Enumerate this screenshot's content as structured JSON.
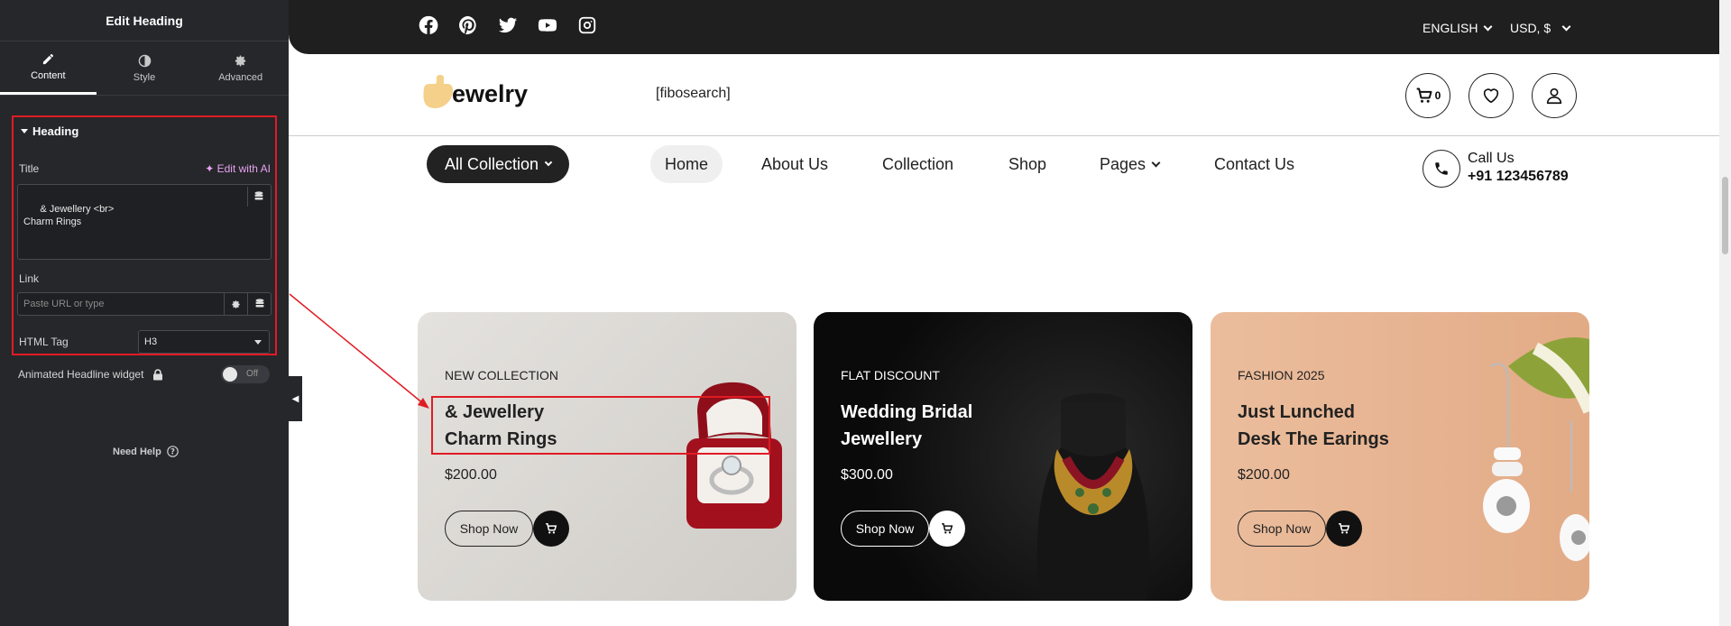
{
  "panel": {
    "title": "Edit Heading",
    "tabs": [
      {
        "label": "Content",
        "icon": "pencil-icon",
        "active": true
      },
      {
        "label": "Style",
        "icon": "half-circle-icon",
        "active": false
      },
      {
        "label": "Advanced",
        "icon": "gear-icon",
        "active": false
      }
    ],
    "section_title": "Heading",
    "title_label": "Title",
    "edit_ai": "Edit with AI",
    "title_value": "& Jewellery <br>\nCharm Rings",
    "link_label": "Link",
    "link_placeholder": "Paste URL or type",
    "html_tag_label": "HTML Tag",
    "html_tag_value": "H3",
    "animated_label": "Animated Headline widget",
    "toggle_label": "Off",
    "need_help": "Need Help"
  },
  "site": {
    "languages": "ENGLISH",
    "currency": "USD, $",
    "logo_text": "Jewelry",
    "search_shortcode": "[fibosearch]",
    "cart_count": "0",
    "all_collection": "All Collection",
    "nav": [
      "Home",
      "About Us",
      "Collection",
      "Shop",
      "Pages",
      "Contact Us"
    ],
    "call_label": "Call Us",
    "call_number": "+91 123456789",
    "social_icons": [
      "facebook-icon",
      "pinterest-icon",
      "twitter-icon",
      "youtube-icon",
      "instagram-icon"
    ]
  },
  "cards": [
    {
      "tag": "NEW COLLECTION",
      "line1": "& Jewellery",
      "line2": "Charm Rings",
      "price": "$200.00",
      "button": "Shop Now"
    },
    {
      "tag": "FLAT DISCOUNT",
      "line1": "Wedding Bridal",
      "line2": "Jewellery",
      "price": "$300.00",
      "button": "Shop Now"
    },
    {
      "tag": "FASHION 2025",
      "line1": "Just Lunched",
      "line2": "Desk The Earings",
      "price": "$200.00",
      "button": "Shop Now"
    }
  ],
  "colors": {
    "accent_red": "#e01b24",
    "ai_purple": "#e8a2f0",
    "dark": "#1f1f1f",
    "card1_bg": "#dcdad6",
    "card2_bg": "#0e0e0e",
    "card3_bg": "#e9b897"
  }
}
